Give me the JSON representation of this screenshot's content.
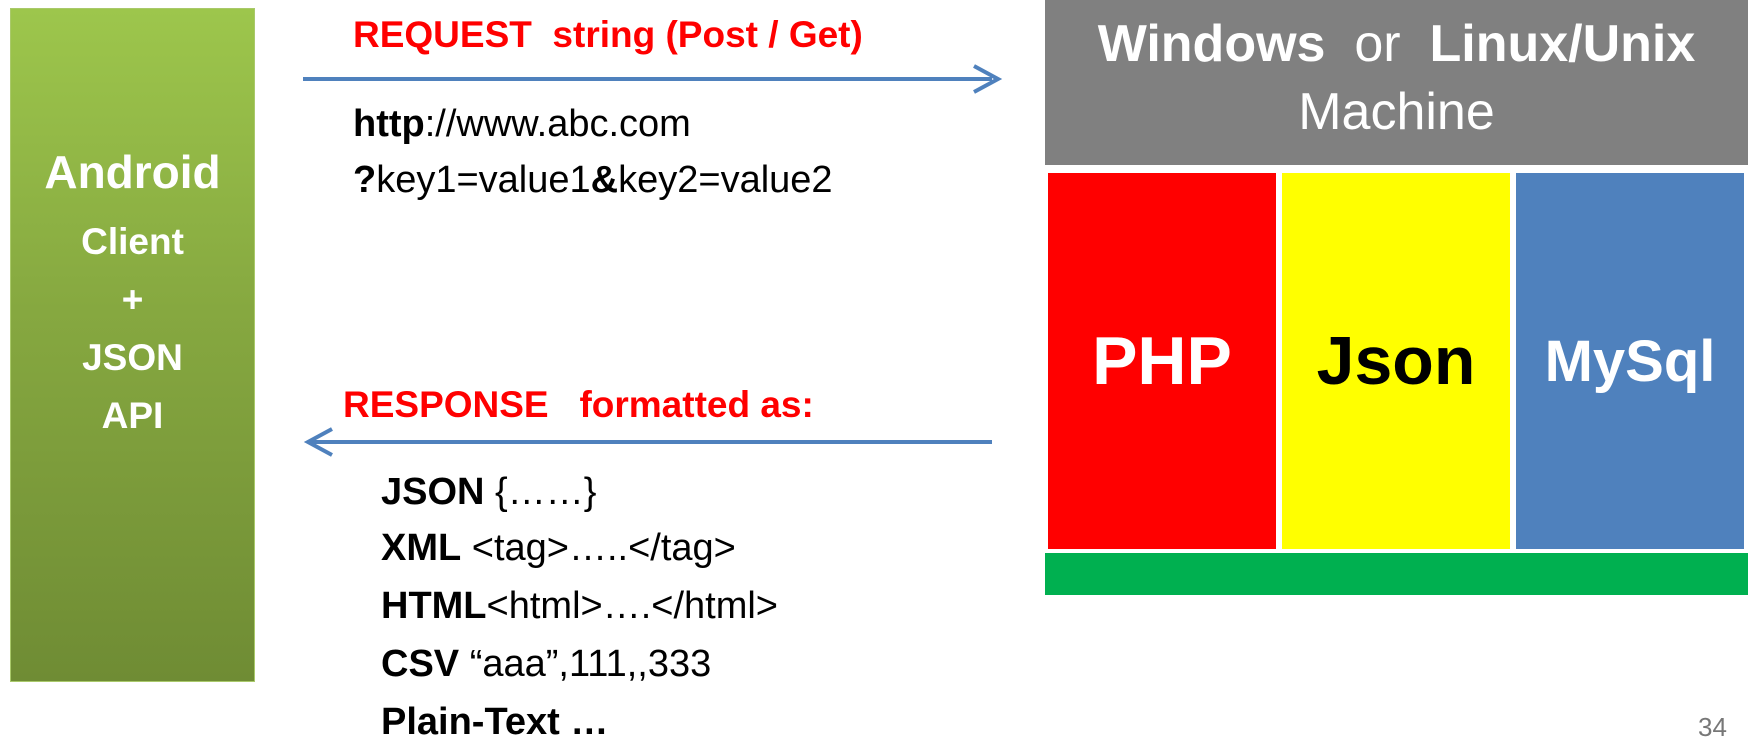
{
  "client": {
    "title": "Android",
    "lines": [
      "Client",
      "+",
      "JSON",
      "API"
    ],
    "color": "#86a840"
  },
  "request": {
    "label": "REQUEST  string (Post / Get)",
    "line1_bold": "http",
    "line1_rest": "://www.abc.com",
    "line2_q": "?",
    "line2_a": "key1=value1",
    "line2_amp": "&",
    "line2_b": "key2=value2"
  },
  "response": {
    "label": "RESPONSE   formatted as:",
    "formats": [
      {
        "name": "JSON",
        "sample": " {……}"
      },
      {
        "name": "XML",
        "sample": " <tag>…..</tag>"
      },
      {
        "name": "HTML",
        "sample": "<html>….</html>"
      },
      {
        "name": "CSV",
        "sample": " “aaa”,111,,333"
      },
      {
        "name": "Plain-Text …",
        "sample": ""
      }
    ]
  },
  "server": {
    "os1": "Windows",
    "or_word": "  or  ",
    "os2": "Linux/Unix",
    "machine": "Machine",
    "columns": [
      {
        "label": "PHP",
        "color": "#ff0000"
      },
      {
        "label": "Json",
        "color": "#ffff00"
      },
      {
        "label": "MySql",
        "color": "#4f81bd"
      }
    ],
    "base_color": "#00b050"
  },
  "arrow_color": "#4f81bd",
  "page_number": "34"
}
